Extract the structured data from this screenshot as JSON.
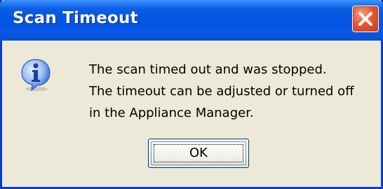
{
  "window": {
    "title": "Scan Timeout"
  },
  "message": {
    "lines": [
      "The scan timed out and was stopped.",
      "The timeout can be adjusted or turned off",
      "in the Appliance Manager."
    ]
  },
  "buttons": {
    "ok_label": "OK"
  },
  "icons": {
    "info": "information-icon",
    "close": "close-icon"
  },
  "colors": {
    "titlebar": "#0553e3",
    "close_button": "#e65a2e",
    "dialog_background": "#ece9d8",
    "info_icon": "#2f6bd8"
  }
}
